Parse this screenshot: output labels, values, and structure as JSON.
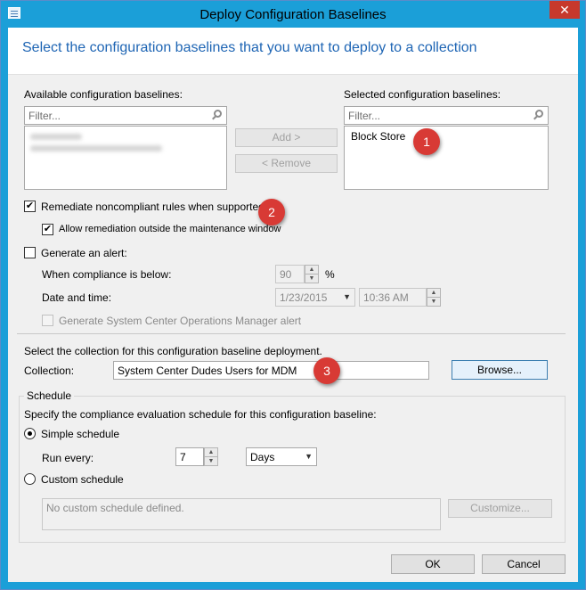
{
  "window": {
    "title": "Deploy Configuration Baselines",
    "close_glyph": "✕"
  },
  "header": {
    "title": "Select the configuration baselines that you want to deploy to a collection"
  },
  "available": {
    "label": "Available configuration baselines:",
    "filter_placeholder": "Filter..."
  },
  "selected": {
    "label": "Selected configuration baselines:",
    "filter_placeholder": "Filter...",
    "items": [
      "Block Store"
    ]
  },
  "buttons": {
    "add": "Add >",
    "remove": "< Remove",
    "browse": "Browse...",
    "customize": "Customize...",
    "ok": "OK",
    "cancel": "Cancel"
  },
  "remediate": {
    "label": "Remediate noncompliant rules when supported",
    "checked": true,
    "outside_window_label": "Allow remediation outside the maintenance window",
    "outside_window_checked": true
  },
  "alert": {
    "label": "Generate an alert:",
    "checked": false,
    "compliance_label": "When compliance is below:",
    "compliance_value": "90",
    "percent": "%",
    "datetime_label": "Date and time:",
    "date_value": "1/23/2015",
    "time_value": "10:36 AM",
    "scom_label": "Generate System Center Operations Manager alert"
  },
  "collection": {
    "prompt": "Select the collection for this configuration baseline deployment.",
    "label": "Collection:",
    "value": "System Center Dudes Users for MDM"
  },
  "schedule": {
    "group_label": "Schedule",
    "prompt": "Specify the compliance evaluation schedule for this configuration baseline:",
    "simple_label": "Simple schedule",
    "run_every_label": "Run every:",
    "run_every_value": "7",
    "unit_value": "Days",
    "custom_label": "Custom schedule",
    "custom_text": "No custom schedule defined."
  },
  "badges": [
    "1",
    "2",
    "3"
  ],
  "colors": {
    "titlebar": "#1b9fd8",
    "header_title": "#1e65b4",
    "badge": "#d83a35",
    "close": "#c7392c"
  }
}
